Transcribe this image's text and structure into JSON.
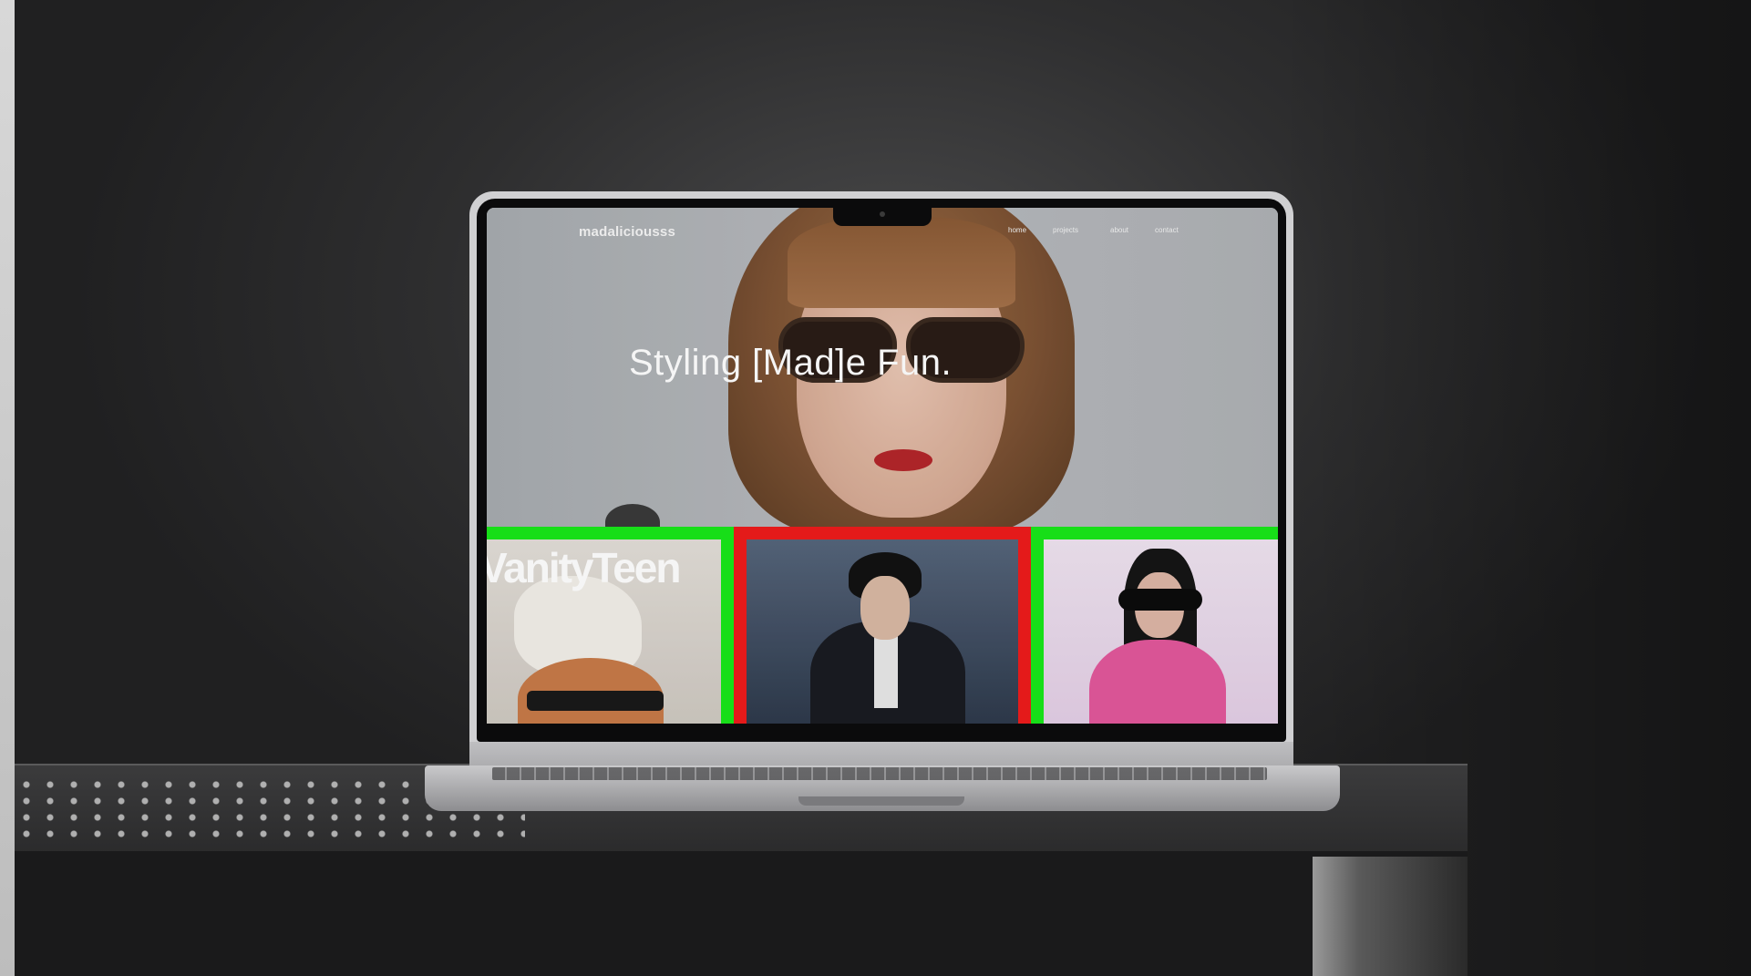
{
  "site": {
    "logo": "madaliciousss",
    "nav": [
      "home",
      "projects",
      "about",
      "contact"
    ],
    "headline": "Styling [Mad]e Fun."
  },
  "tiles": [
    {
      "magazine_title": "VanityTeen",
      "frame_color": "#18e81a"
    },
    {
      "frame_color": "#ee1c1c"
    },
    {
      "frame_color": "#18e81a"
    }
  ],
  "colors": {
    "accent_green": "#18e81a",
    "accent_red": "#ee1c1c",
    "background": "#1f1f20"
  }
}
